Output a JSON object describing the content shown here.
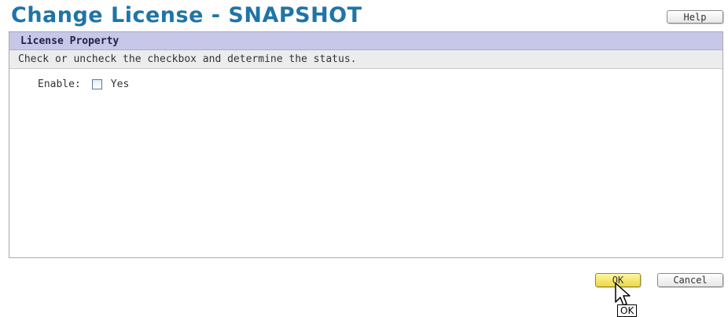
{
  "header": {
    "title": "Change License - SNAPSHOT",
    "help_label": "Help"
  },
  "panel": {
    "title": "License Property",
    "description": "Check or uncheck the checkbox and determine the status.",
    "enable_field": {
      "label": "Enable:",
      "option_label": "Yes",
      "checked": false
    }
  },
  "footer": {
    "ok_label": "OK",
    "cancel_label": "Cancel",
    "tooltip_text": "OK"
  },
  "icons": {
    "cursor": "arrow-pointer-icon"
  },
  "colors": {
    "title": "#1f74a8",
    "panel_header_bg": "#c7c7ea",
    "description_bg": "#ececec",
    "ok_button_bg": "#f2e47a"
  }
}
